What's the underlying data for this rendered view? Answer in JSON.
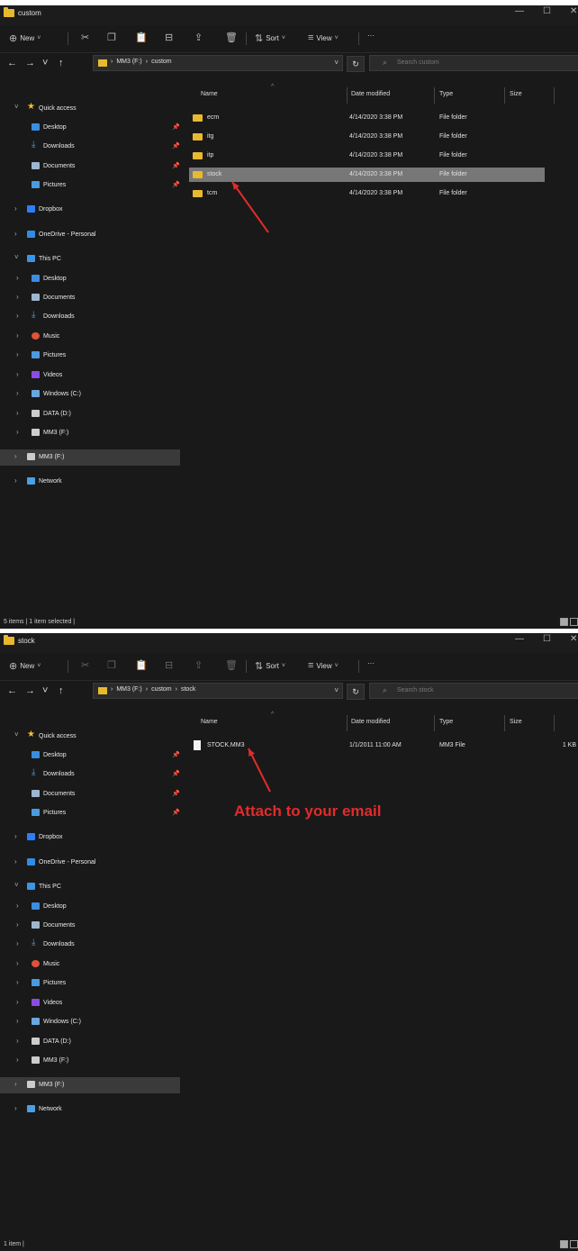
{
  "windows": [
    {
      "title": "custom",
      "toolbar": {
        "new_label": "New",
        "sort_label": "Sort",
        "view_label": "View",
        "more_label": "···"
      },
      "breadcrumb": [
        "MM3 (F:)",
        "custom"
      ],
      "search_placeholder": "Search custom",
      "columns": {
        "name": "Name",
        "date": "Date modified",
        "type": "Type",
        "size": "Size"
      },
      "files": [
        {
          "name": "ecm",
          "date": "4/14/2020 3:38 PM",
          "type": "File folder",
          "size": "",
          "kind": "folder",
          "selected": false
        },
        {
          "name": "itg",
          "date": "4/14/2020 3:38 PM",
          "type": "File folder",
          "size": "",
          "kind": "folder",
          "selected": false
        },
        {
          "name": "itp",
          "date": "4/14/2020 3:38 PM",
          "type": "File folder",
          "size": "",
          "kind": "folder",
          "selected": false
        },
        {
          "name": "stock",
          "date": "4/14/2020 3:38 PM",
          "type": "File folder",
          "size": "",
          "kind": "folder",
          "selected": true
        },
        {
          "name": "tcm",
          "date": "4/14/2020 3:38 PM",
          "type": "File folder",
          "size": "",
          "kind": "folder",
          "selected": false
        }
      ],
      "status": "5 items  |  1 item selected  |",
      "annotation": ""
    },
    {
      "title": "stock",
      "toolbar": {
        "new_label": "New",
        "sort_label": "Sort",
        "view_label": "View",
        "more_label": "···"
      },
      "breadcrumb": [
        "MM3 (F:)",
        "custom",
        "stock"
      ],
      "search_placeholder": "Search stock",
      "columns": {
        "name": "Name",
        "date": "Date modified",
        "type": "Type",
        "size": "Size"
      },
      "files": [
        {
          "name": "STOCK.MM3",
          "date": "1/1/2011 11:00 AM",
          "type": "MM3 File",
          "size": "1 KB",
          "kind": "file",
          "selected": false
        }
      ],
      "status": "1 item  |",
      "annotation": "Attach to your email"
    }
  ],
  "sidebar": [
    {
      "label": "Quick access",
      "icon": "star-icon",
      "color": "#f2c12e",
      "indent": 1,
      "chevron": "expanded",
      "pinned": false
    },
    {
      "label": "Desktop",
      "icon": "desktop-icon",
      "color": "#3a8de0",
      "indent": 2,
      "chevron": "",
      "pinned": true
    },
    {
      "label": "Downloads",
      "icon": "download-icon",
      "color": "#4aa0e6",
      "indent": 2,
      "chevron": "",
      "pinned": true
    },
    {
      "label": "Documents",
      "icon": "document-icon",
      "color": "#9fb6cf",
      "indent": 2,
      "chevron": "",
      "pinned": true
    },
    {
      "label": "Pictures",
      "icon": "pictures-icon",
      "color": "#4a9ae0",
      "indent": 2,
      "chevron": "",
      "pinned": true
    },
    {
      "label": "Dropbox",
      "icon": "dropbox-icon",
      "color": "#2d7ff9",
      "indent": 1,
      "chevron": "collapsed",
      "pinned": false
    },
    {
      "label": "OneDrive - Personal",
      "icon": "onedrive-icon",
      "color": "#2f8de4",
      "indent": 1,
      "chevron": "collapsed",
      "pinned": false
    },
    {
      "label": "This PC",
      "icon": "computer-icon",
      "color": "#3b95e6",
      "indent": 1,
      "chevron": "expanded",
      "pinned": false
    },
    {
      "label": "Desktop",
      "icon": "desktop-icon",
      "color": "#3a8de0",
      "indent": 2,
      "chevron": "collapsed",
      "pinned": false
    },
    {
      "label": "Documents",
      "icon": "document-icon",
      "color": "#9fb6cf",
      "indent": 2,
      "chevron": "collapsed",
      "pinned": false
    },
    {
      "label": "Downloads",
      "icon": "download-icon",
      "color": "#4aa0e6",
      "indent": 2,
      "chevron": "collapsed",
      "pinned": false
    },
    {
      "label": "Music",
      "icon": "music-icon",
      "color": "#e0523a",
      "indent": 2,
      "chevron": "collapsed",
      "pinned": false
    },
    {
      "label": "Pictures",
      "icon": "pictures-icon",
      "color": "#4a9ae0",
      "indent": 2,
      "chevron": "collapsed",
      "pinned": false
    },
    {
      "label": "Videos",
      "icon": "videos-icon",
      "color": "#8a4de0",
      "indent": 2,
      "chevron": "collapsed",
      "pinned": false
    },
    {
      "label": "Windows (C:)",
      "icon": "windows-drive-icon",
      "color": "#6aa6e0",
      "indent": 2,
      "chevron": "collapsed",
      "pinned": false
    },
    {
      "label": "DATA (D:)",
      "icon": "drive-icon",
      "color": "#cccccc",
      "indent": 2,
      "chevron": "collapsed",
      "pinned": false
    },
    {
      "label": "MM3 (F:)",
      "icon": "drive-icon",
      "color": "#cccccc",
      "indent": 2,
      "chevron": "collapsed",
      "pinned": false
    },
    {
      "label": "MM3 (F:)",
      "icon": "drive-icon",
      "color": "#cccccc",
      "indent": 1,
      "chevron": "collapsed",
      "pinned": false,
      "selected": true
    },
    {
      "label": "Network",
      "icon": "network-icon",
      "color": "#4aa0e6",
      "indent": 1,
      "chevron": "collapsed",
      "pinned": false
    }
  ],
  "colors": {
    "window_bg": "#191919",
    "selection": "#777777",
    "folder": "#e8b92e",
    "annotation": "#e22b2b"
  }
}
